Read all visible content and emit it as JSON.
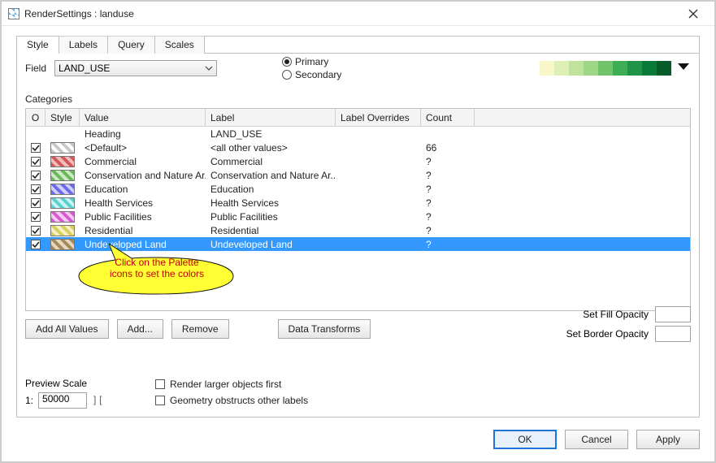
{
  "title": "RenderSettings : landuse",
  "tabs": [
    "Style",
    "Labels",
    "Query",
    "Scales"
  ],
  "active_tab": 0,
  "field_label": "Field",
  "field_value": "LAND_USE",
  "radios": {
    "primary": "Primary",
    "secondary": "Secondary",
    "selected": "primary"
  },
  "palette_colors": [
    "#f7f7c8",
    "#deefb6",
    "#bfe39d",
    "#9dd684",
    "#71c36a",
    "#3fad56",
    "#1f9447",
    "#0a7a38",
    "#065c29"
  ],
  "categories_label": "Categories",
  "grid_headers": {
    "o": "O",
    "style": "Style",
    "value": "Value",
    "label": "Label",
    "overrides": "Label Overrides",
    "count": "Count"
  },
  "heading_row": {
    "value": "Heading",
    "label": "LAND_USE"
  },
  "rows": [
    {
      "checked": true,
      "style_class": "hatch-gray",
      "value": "<Default>",
      "label": "<all other values>",
      "count": "66",
      "selected": false
    },
    {
      "checked": true,
      "style_class": "hatch-red",
      "value": "Commercial",
      "label": "Commercial",
      "count": "?",
      "selected": false
    },
    {
      "checked": true,
      "style_class": "hatch-green",
      "value": "Conservation and Nature Ar...",
      "label": "Conservation and Nature Ar...",
      "count": "?",
      "selected": false
    },
    {
      "checked": true,
      "style_class": "hatch-blue",
      "value": "Education",
      "label": "Education",
      "count": "?",
      "selected": false
    },
    {
      "checked": true,
      "style_class": "hatch-cyan",
      "value": "Health Services",
      "label": "Health Services",
      "count": "?",
      "selected": false
    },
    {
      "checked": true,
      "style_class": "hatch-magenta",
      "value": "Public Facilities",
      "label": "Public Facilities",
      "count": "?",
      "selected": false
    },
    {
      "checked": true,
      "style_class": "hatch-yellow",
      "value": "Residential",
      "label": "Residential",
      "count": "?",
      "selected": false
    },
    {
      "checked": true,
      "style_class": "hatch-brown",
      "value": "Undeveloped Land",
      "label": "Undeveloped Land",
      "count": "?",
      "selected": true
    }
  ],
  "callout_text1": "Click on the Palette",
  "callout_text2": "icons to set the colors",
  "buttons": {
    "add_all": "Add All Values",
    "add": "Add...",
    "remove": "Remove",
    "transforms": "Data Transforms"
  },
  "opacity": {
    "fill_label": "Set Fill Opacity",
    "border_label": "Set Border Opacity",
    "fill_value": "",
    "border_value": ""
  },
  "preview": {
    "label": "Preview Scale",
    "prefix": "1:",
    "value": "50000"
  },
  "render_opts": {
    "larger_first": "Render larger objects first",
    "obstruct": "Geometry obstructs other labels"
  },
  "footer": {
    "ok": "OK",
    "cancel": "Cancel",
    "apply": "Apply"
  }
}
